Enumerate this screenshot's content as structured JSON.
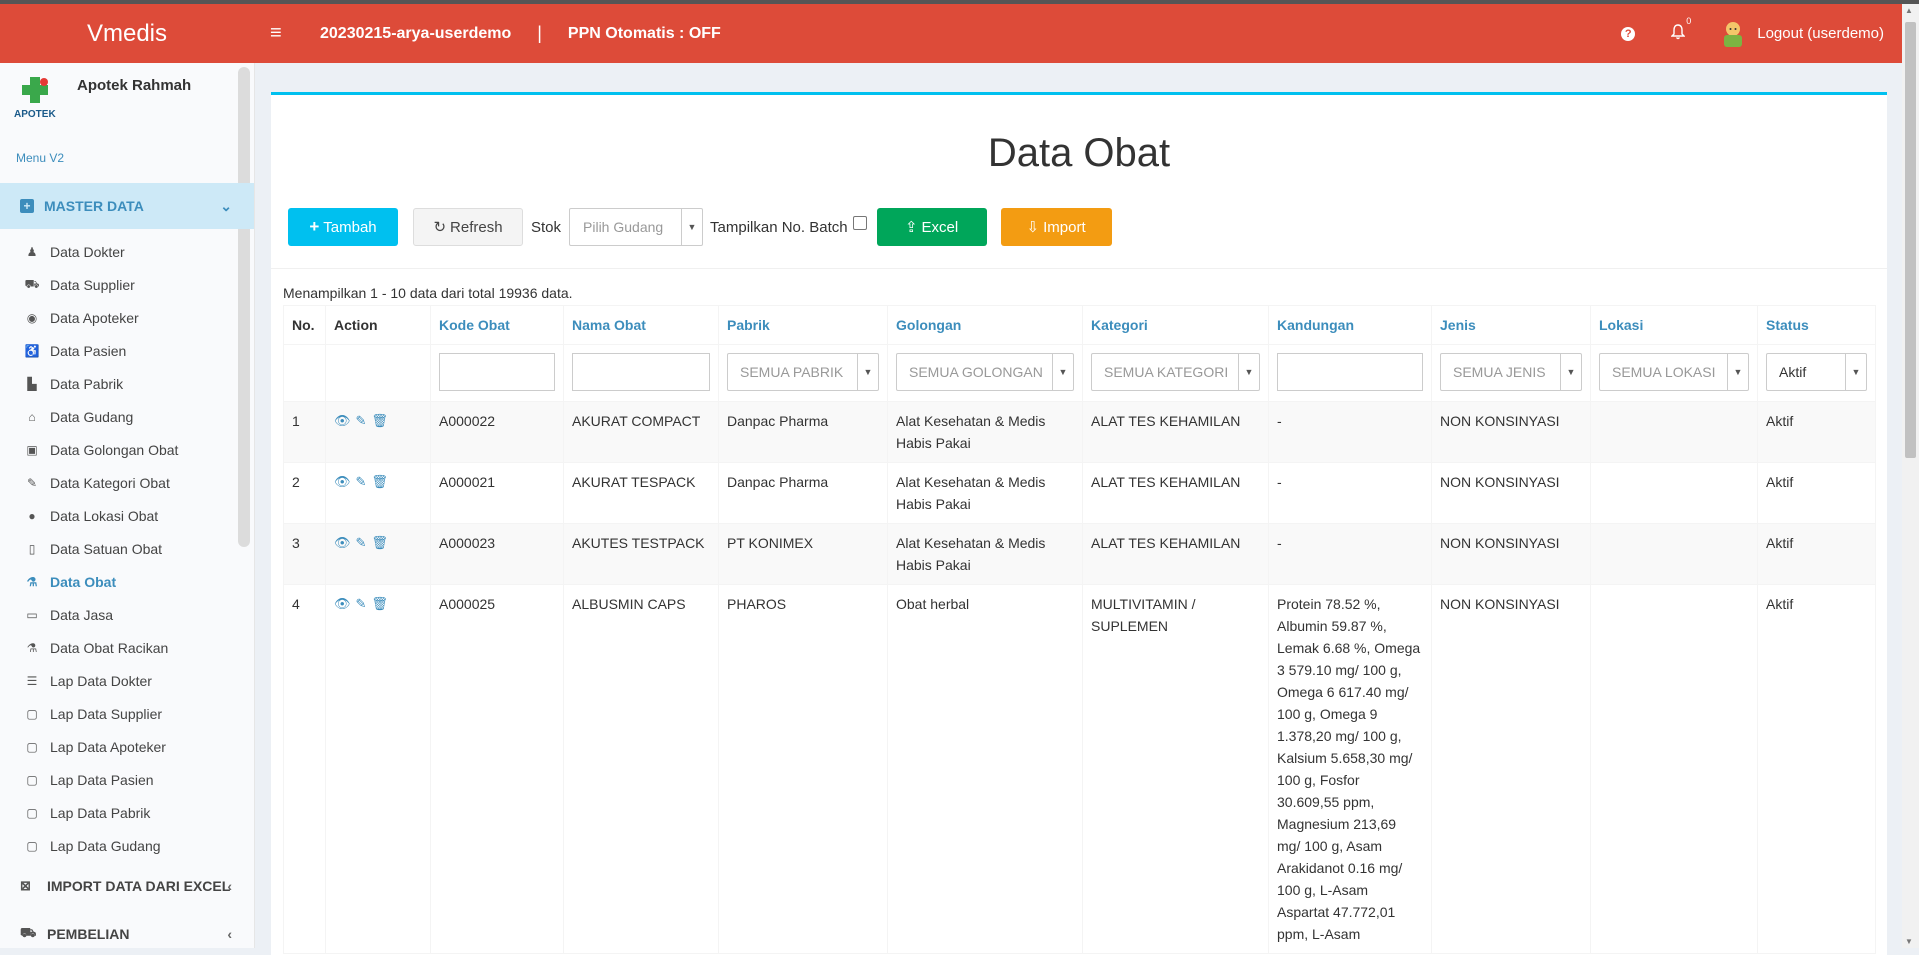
{
  "header": {
    "brand": "Vmedis",
    "session": "20230215-arya-userdemo",
    "separator": "|",
    "ppn": "PPN Otomatis : OFF",
    "notif_count": "0",
    "logout": "Logout (userdemo)",
    "help_glyph": "?"
  },
  "sidebar": {
    "pharmacy_name": "Apotek Rahmah",
    "logo_text": "APOTEK",
    "menu_version": "Menu V2",
    "active_section": "MASTER DATA",
    "items": [
      {
        "label": "Data Dokter",
        "icon": "doctor-icon",
        "glyph": "♟"
      },
      {
        "label": "Data Supplier",
        "icon": "truck-icon",
        "glyph": "⛟"
      },
      {
        "label": "Data Apoteker",
        "icon": "user-circle-icon",
        "glyph": "◉"
      },
      {
        "label": "Data Pasien",
        "icon": "wheelchair-icon",
        "glyph": "♿"
      },
      {
        "label": "Data Pabrik",
        "icon": "industry-icon",
        "glyph": "▙"
      },
      {
        "label": "Data Gudang",
        "icon": "home-icon",
        "glyph": "⌂"
      },
      {
        "label": "Data Golongan Obat",
        "icon": "group-icon",
        "glyph": "▣"
      },
      {
        "label": "Data Kategori Obat",
        "icon": "eyedropper-icon",
        "glyph": "✎"
      },
      {
        "label": "Data Lokasi Obat",
        "icon": "map-marker-icon",
        "glyph": "●"
      },
      {
        "label": "Data Satuan Obat",
        "icon": "bookmark-icon",
        "glyph": "▯"
      },
      {
        "label": "Data Obat",
        "icon": "flask-icon",
        "glyph": "⚗"
      },
      {
        "label": "Data Jasa",
        "icon": "credit-card-icon",
        "glyph": "▭"
      },
      {
        "label": "Data Obat Racikan",
        "icon": "flask-icon",
        "glyph": "⚗"
      },
      {
        "label": "Lap Data Dokter",
        "icon": "list-icon",
        "glyph": "☰"
      },
      {
        "label": "Lap Data Supplier",
        "icon": "pdf-file-icon",
        "glyph": "▢"
      },
      {
        "label": "Lap Data Apoteker",
        "icon": "pdf-file-icon",
        "glyph": "▢"
      },
      {
        "label": "Lap Data Pasien",
        "icon": "pdf-file-icon",
        "glyph": "▢"
      },
      {
        "label": "Lap Data Pabrik",
        "icon": "pdf-file-icon",
        "glyph": "▢"
      },
      {
        "label": "Lap Data Gudang",
        "icon": "pdf-file-icon",
        "glyph": "▢"
      }
    ],
    "sections": [
      {
        "label": "IMPORT DATA DARI EXCEL",
        "icon": "excel-file-icon",
        "glyph": "⊠"
      },
      {
        "label": "PEMBELIAN",
        "icon": "truck-icon",
        "glyph": "⛟"
      }
    ]
  },
  "page": {
    "title": "Data Obat",
    "buttons": {
      "tambah": "Tambah",
      "refresh": "Refresh",
      "stok": "Stok",
      "gudang_placeholder": "Pilih Gudang",
      "batch": "Tampilkan No. Batch",
      "excel": "Excel",
      "import": "Import"
    },
    "summary": "Menampilkan 1 - 10 data dari total 19936 data."
  },
  "table": {
    "columns": [
      "No.",
      "Action",
      "Kode Obat",
      "Nama Obat",
      "Pabrik",
      "Golongan",
      "Kategori",
      "Kandungan",
      "Jenis",
      "Lokasi",
      "Status"
    ],
    "filters": {
      "pabrik": "SEMUA PABRIK",
      "golongan": "SEMUA GOLONGAN",
      "kategori": "SEMUA KATEGORI",
      "jenis": "SEMUA JENIS",
      "lokasi": "SEMUA LOKASI",
      "status": "Aktif"
    },
    "rows": [
      {
        "no": "1",
        "kode": "A000022",
        "nama": "AKURAT COMPACT",
        "pabrik": "Danpac Pharma",
        "golongan": "Alat Kesehatan & Medis Habis Pakai",
        "kategori": "ALAT TES KEHAMILAN",
        "kandungan": "-",
        "jenis": "NON KONSINYASI",
        "lokasi": "",
        "status": "Aktif"
      },
      {
        "no": "2",
        "kode": "A000021",
        "nama": "AKURAT TESPACK",
        "pabrik": "Danpac Pharma",
        "golongan": "Alat Kesehatan & Medis Habis Pakai",
        "kategori": "ALAT TES KEHAMILAN",
        "kandungan": "-",
        "jenis": "NON KONSINYASI",
        "lokasi": "",
        "status": "Aktif"
      },
      {
        "no": "3",
        "kode": "A000023",
        "nama": "AKUTES TESTPACK",
        "pabrik": "PT KONIMEX",
        "golongan": "Alat Kesehatan & Medis Habis Pakai",
        "kategori": "ALAT TES KEHAMILAN",
        "kandungan": "-",
        "jenis": "NON KONSINYASI",
        "lokasi": "",
        "status": "Aktif"
      },
      {
        "no": "4",
        "kode": "A000025",
        "nama": "ALBUSMIN CAPS",
        "pabrik": "PHAROS",
        "golongan": "Obat herbal",
        "kategori": "MULTIVITAMIN / SUPLEMEN",
        "kandungan": "Protein 78.52 %, Albumin 59.87 %, Lemak 6.68 %, Omega 3 579.10 mg/ 100 g, Omega 6 617.40 mg/ 100 g, Omega 9 1.378,20 mg/ 100 g, Kalsium 5.658,30 mg/ 100 g, Fosfor 30.609,55 ppm, Magnesium 213,69 mg/ 100 g, Asam Arakidanot 0.16 mg/ 100 g, L-Asam Aspartat 47.772,01 ppm, L-Asam",
        "jenis": "NON KONSINYASI",
        "lokasi": "",
        "status": "Aktif"
      }
    ]
  }
}
